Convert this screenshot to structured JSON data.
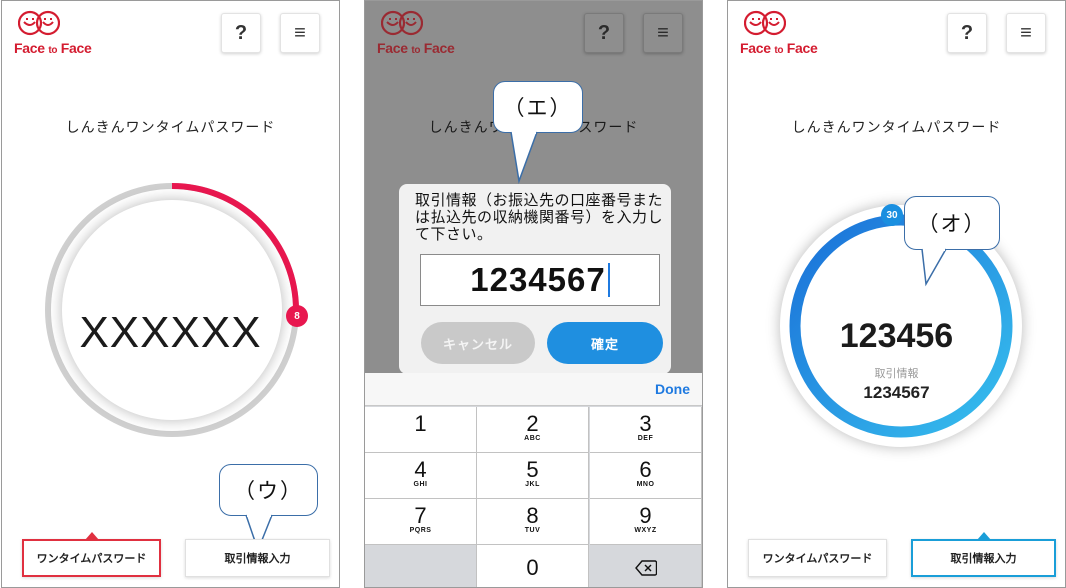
{
  "brand": {
    "name_face1": "Face",
    "name_to": "to",
    "name_face2": "Face",
    "color": "#d41c30"
  },
  "header": {
    "help_label": "?",
    "menu_label": "≡"
  },
  "screen_title": "しんきんワンタイムパスワード",
  "panel1": {
    "otp_masked": "XXXXXX",
    "countdown": "8",
    "countdown_color": "#e8174f",
    "callout": "（ウ）"
  },
  "panel2": {
    "callout": "（エ）",
    "dialog": {
      "message": "取引情報（お振込先の口座番号または払込先の収納機関番号）を入力して下さい。",
      "input_value": "1234567",
      "cancel_label": "キャンセル",
      "confirm_label": "確定"
    },
    "keyboard": {
      "done_label": "Done",
      "keys": [
        {
          "num": "1",
          "letters": ""
        },
        {
          "num": "2",
          "letters": "ABC"
        },
        {
          "num": "3",
          "letters": "DEF"
        },
        {
          "num": "4",
          "letters": "GHI"
        },
        {
          "num": "5",
          "letters": "JKL"
        },
        {
          "num": "6",
          "letters": "MNO"
        },
        {
          "num": "7",
          "letters": "PQRS"
        },
        {
          "num": "8",
          "letters": "TUV"
        },
        {
          "num": "9",
          "letters": "WXYZ"
        },
        {
          "num": "0",
          "letters": ""
        }
      ]
    }
  },
  "panel3": {
    "otp": "123456",
    "txn_label": "取引情報",
    "txn_value": "1234567",
    "countdown": "30",
    "countdown_color": "#1a8fe0",
    "callout": "（オ）"
  },
  "tabs": {
    "otp_label": "ワンタイムパスワード",
    "txn_label": "取引情報入力"
  },
  "colors": {
    "active_red": "#e03040",
    "active_blue": "#1a9ed8",
    "accent_blue": "#1f8fe0"
  }
}
